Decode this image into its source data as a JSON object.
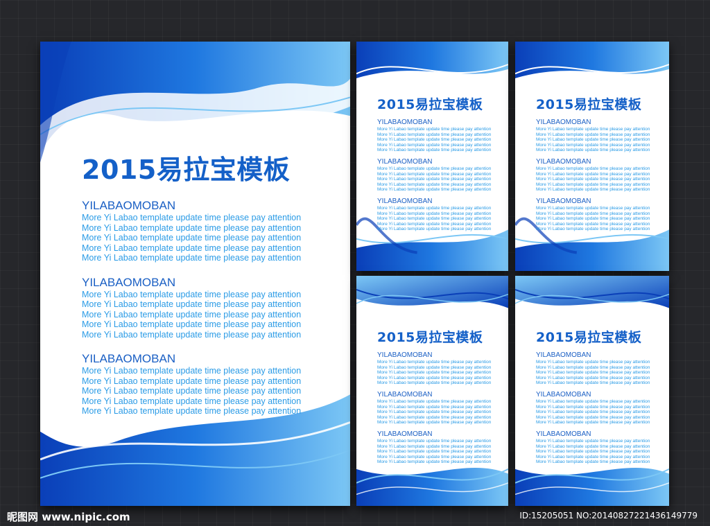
{
  "colors": {
    "background": "#26272b",
    "wave_dark": "#0a3fb8",
    "wave_mid": "#1f78e0",
    "wave_light": "#7cc7f5",
    "title": "#1460c8",
    "text": "#2a9be6"
  },
  "posters": [
    {
      "title": "2015易拉宝模板",
      "blocks": [
        {
          "heading": "YILABAOMOBAN",
          "lines": [
            "More Yi Labao template update time please pay attention",
            "More Yi Labao template update time please pay attention",
            "More Yi Labao template update time please pay attention",
            "More Yi Labao template update time please pay attention",
            "More Yi Labao template update time please pay attention"
          ]
        },
        {
          "heading": "YILABAOMOBAN",
          "lines": [
            "More Yi Labao template update time please pay attention",
            "More Yi Labao template update time please pay attention",
            "More Yi Labao template update time please pay attention",
            "More Yi Labao template update time please pay attention",
            "More Yi Labao template update time please pay attention"
          ]
        },
        {
          "heading": "YILABAOMOBAN",
          "lines": [
            "More Yi Labao template update time please pay attention",
            "More Yi Labao template update time please pay attention",
            "More Yi Labao template update time please pay attention",
            "More Yi Labao template update time please pay attention",
            "More Yi Labao template update time please pay attention"
          ]
        }
      ]
    },
    {
      "title": "2015易拉宝模板",
      "blocks": [
        {
          "heading": "YILABAOMOBAN",
          "lines": [
            "More Yi Labao template update time please pay attention",
            "More Yi Labao template update time please pay attention",
            "More Yi Labao template update time please pay attention",
            "More Yi Labao template update time please pay attention",
            "More Yi Labao template update time please pay attention"
          ]
        },
        {
          "heading": "YILABAOMOBAN",
          "lines": [
            "More Yi Labao template update time please pay attention",
            "More Yi Labao template update time please pay attention",
            "More Yi Labao template update time please pay attention",
            "More Yi Labao template update time please pay attention",
            "More Yi Labao template update time please pay attention"
          ]
        },
        {
          "heading": "YILABAOMOBAN",
          "lines": [
            "More Yi Labao template update time please pay attention",
            "More Yi Labao template update time please pay attention",
            "More Yi Labao template update time please pay attention",
            "More Yi Labao template update time please pay attention",
            "More Yi Labao template update time please pay attention"
          ]
        }
      ]
    },
    {
      "title": "2015易拉宝模板",
      "blocks": [
        {
          "heading": "YILABAOMOBAN",
          "lines": [
            "More Yi Labao template update time please pay attention",
            "More Yi Labao template update time please pay attention",
            "More Yi Labao template update time please pay attention",
            "More Yi Labao template update time please pay attention",
            "More Yi Labao template update time please pay attention"
          ]
        },
        {
          "heading": "YILABAOMOBAN",
          "lines": [
            "More Yi Labao template update time please pay attention",
            "More Yi Labao template update time please pay attention",
            "More Yi Labao template update time please pay attention",
            "More Yi Labao template update time please pay attention",
            "More Yi Labao template update time please pay attention"
          ]
        },
        {
          "heading": "YILABAOMOBAN",
          "lines": [
            "More Yi Labao template update time please pay attention",
            "More Yi Labao template update time please pay attention",
            "More Yi Labao template update time please pay attention",
            "More Yi Labao template update time please pay attention",
            "More Yi Labao template update time please pay attention"
          ]
        }
      ]
    },
    {
      "title": "2015易拉宝模板",
      "blocks": [
        {
          "heading": "YILABAOMOBAN",
          "lines": [
            "More Yi Labao template update time please pay attention",
            "More Yi Labao template update time please pay attention",
            "More Yi Labao template update time please pay attention",
            "More Yi Labao template update time please pay attention",
            "More Yi Labao template update time please pay attention"
          ]
        },
        {
          "heading": "YILABAOMOBAN",
          "lines": [
            "More Yi Labao template update time please pay attention",
            "More Yi Labao template update time please pay attention",
            "More Yi Labao template update time please pay attention",
            "More Yi Labao template update time please pay attention",
            "More Yi Labao template update time please pay attention"
          ]
        },
        {
          "heading": "YILABAOMOBAN",
          "lines": [
            "More Yi Labao template update time please pay attention",
            "More Yi Labao template update time please pay attention",
            "More Yi Labao template update time please pay attention",
            "More Yi Labao template update time please pay attention",
            "More Yi Labao template update time please pay attention"
          ]
        }
      ]
    },
    {
      "title": "2015易拉宝模板",
      "blocks": [
        {
          "heading": "YILABAOMOBAN",
          "lines": [
            "More Yi Labao template update time please pay attention",
            "More Yi Labao template update time please pay attention",
            "More Yi Labao template update time please pay attention",
            "More Yi Labao template update time please pay attention",
            "More Yi Labao template update time please pay attention"
          ]
        },
        {
          "heading": "YILABAOMOBAN",
          "lines": [
            "More Yi Labao template update time please pay attention",
            "More Yi Labao template update time please pay attention",
            "More Yi Labao template update time please pay attention",
            "More Yi Labao template update time please pay attention",
            "More Yi Labao template update time please pay attention"
          ]
        },
        {
          "heading": "YILABAOMOBAN",
          "lines": [
            "More Yi Labao template update time please pay attention",
            "More Yi Labao template update time please pay attention",
            "More Yi Labao template update time please pay attention",
            "More Yi Labao template update time please pay attention",
            "More Yi Labao template update time please pay attention"
          ]
        }
      ]
    }
  ],
  "watermark": {
    "logo_text": "昵图网 www.nipic.com",
    "id_text": "ID:15205051 NO:20140827221436149779"
  }
}
